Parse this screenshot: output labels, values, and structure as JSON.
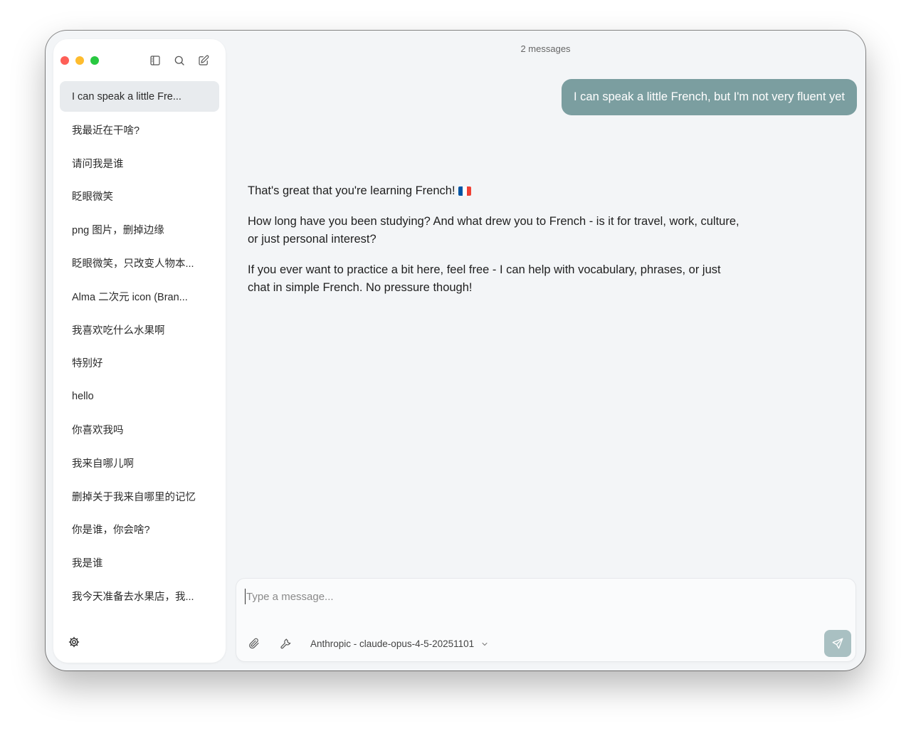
{
  "window": {
    "traffic_lights": [
      "close",
      "minimize",
      "zoom"
    ],
    "toolbar_icons": [
      "sidebar-icon",
      "search-icon",
      "compose-icon"
    ]
  },
  "sidebar": {
    "conversations": [
      {
        "label": "I can speak a little Fre...",
        "active": true
      },
      {
        "label": "我最近在干啥?"
      },
      {
        "label": "请问我是谁"
      },
      {
        "label": "眨眼微笑"
      },
      {
        "label": "png 图片，删掉边缘"
      },
      {
        "label": "眨眼微笑，只改变人物本..."
      },
      {
        "label": "Alma 二次元 icon (Bran..."
      },
      {
        "label": "我喜欢吃什么水果啊"
      },
      {
        "label": "特别好"
      },
      {
        "label": "hello"
      },
      {
        "label": "你喜欢我吗"
      },
      {
        "label": "我来自哪儿啊"
      },
      {
        "label": "删掉关于我来自哪里的记忆"
      },
      {
        "label": "你是谁，你会啥?"
      },
      {
        "label": "我是谁"
      },
      {
        "label": "我今天准备去水果店，我..."
      }
    ],
    "settings_icon": "gear-icon"
  },
  "chat": {
    "message_count": "2 messages",
    "user_message": "I can speak a little French, but I'm not very fluent yet",
    "assistant_paragraphs": [
      "That's great that you're learning French!",
      "How long have you been studying? And what drew you to French - is it for travel, work, culture, or just personal interest?",
      "If you ever want to practice a bit here, feel free - I can help with vocabulary, phrases, or just chat in simple French. No pressure though!"
    ],
    "flag_emoji": "french-flag-icon"
  },
  "composer": {
    "placeholder": "Type a message...",
    "value": "",
    "attach_icon": "paperclip-icon",
    "tools_icon": "wrench-icon",
    "model": "Anthropic - claude-opus-4-5-20251101",
    "send_icon": "send-icon"
  },
  "colors": {
    "user_bubble": "#7b9ea0",
    "send_button": "#a9c0c2",
    "active_conversation": "#e8ebee",
    "window_background": "#f3f5f7"
  }
}
